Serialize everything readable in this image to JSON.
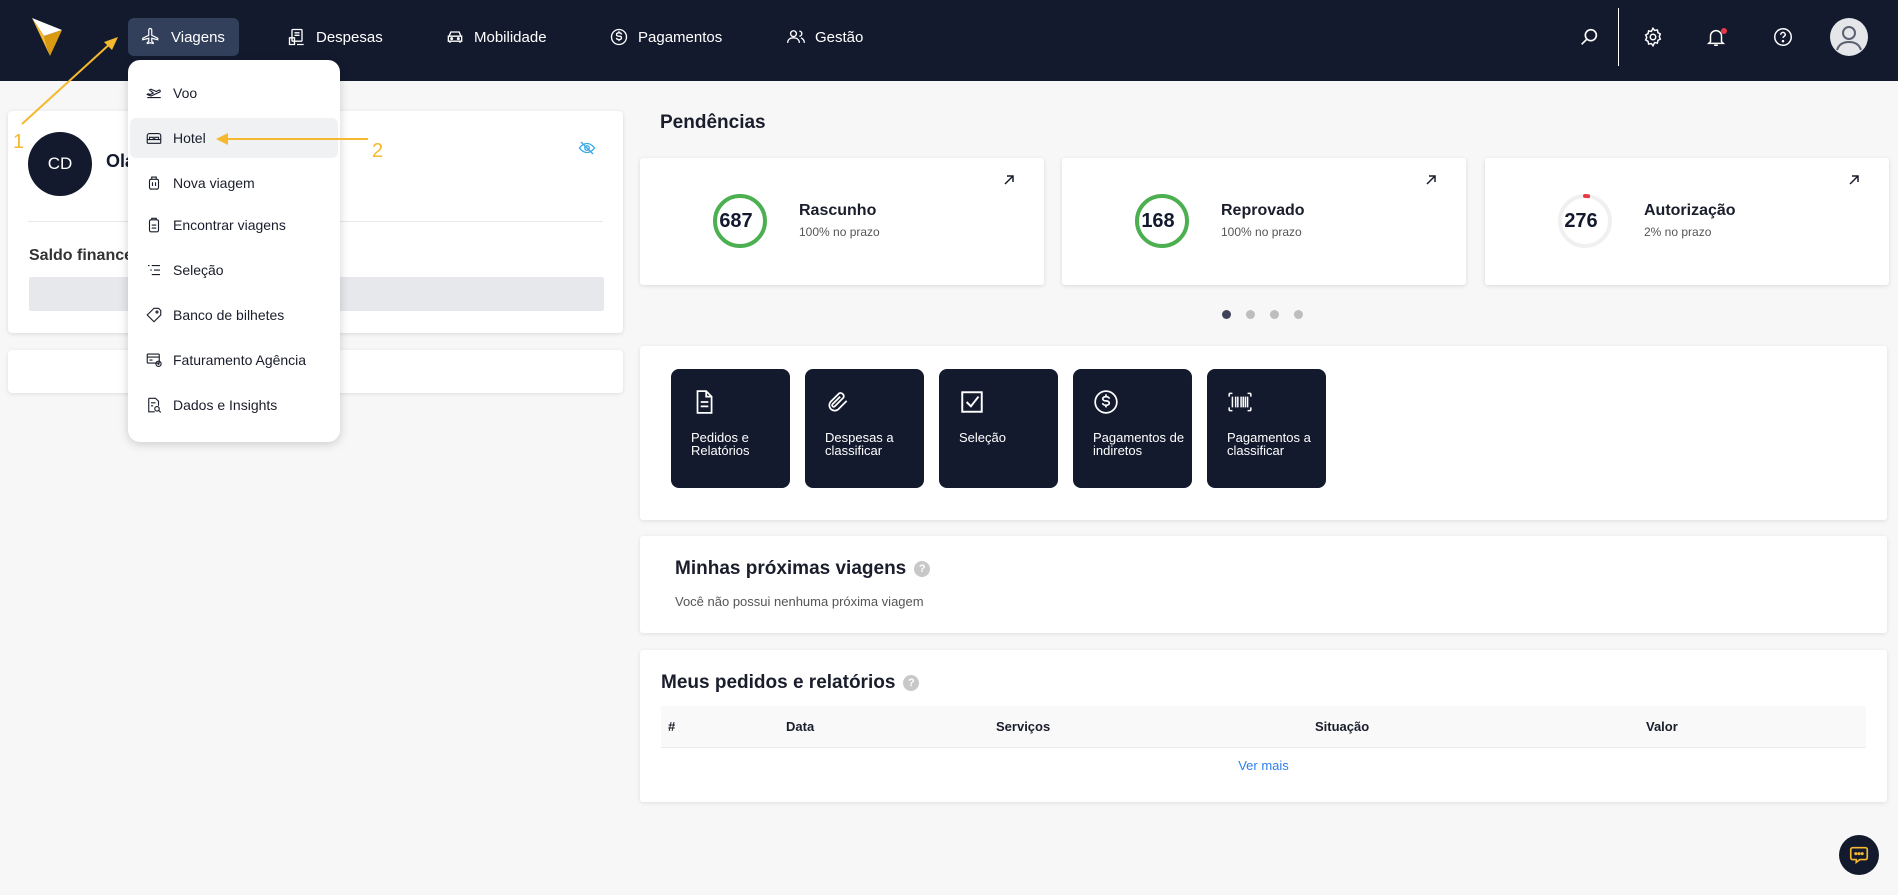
{
  "nav": {
    "items": [
      {
        "label": "Viagens",
        "icon": "plane-icon"
      },
      {
        "label": "Despesas",
        "icon": "receipt-icon"
      },
      {
        "label": "Mobilidade",
        "icon": "car-icon"
      },
      {
        "label": "Pagamentos",
        "icon": "dollar-icon"
      },
      {
        "label": "Gestão",
        "icon": "users-icon"
      }
    ],
    "active": "Viagens",
    "icons_right": [
      "search-icon",
      "gear-icon",
      "bell-icon",
      "help-icon",
      "user-avatar-icon"
    ]
  },
  "dropdown": {
    "items": [
      {
        "label": "Voo",
        "icon": "plane-takeoff-icon"
      },
      {
        "label": "Hotel",
        "icon": "bed-icon"
      },
      {
        "label": "Nova viagem",
        "icon": "luggage-icon"
      },
      {
        "label": "Encontrar viagens",
        "icon": "clipboard-icon"
      },
      {
        "label": "Seleção",
        "icon": "list-icon"
      },
      {
        "label": "Banco de bilhetes",
        "icon": "ticket-icon"
      },
      {
        "label": "Faturamento Agência",
        "icon": "billing-icon"
      },
      {
        "label": "Dados e Insights",
        "icon": "insights-icon"
      }
    ],
    "highlighted": "Hotel"
  },
  "annotations": {
    "step1": "1",
    "step2": "2"
  },
  "profile": {
    "initials": "CD",
    "greeting": "Olá",
    "saldo_label": "Saldo financeiro"
  },
  "pendencias": {
    "title": "Pendências",
    "cards": [
      {
        "count": "687",
        "label": "Rascunho",
        "sub": "100% no prazo",
        "progress": 1.0
      },
      {
        "count": "168",
        "label": "Reprovado",
        "sub": "100% no prazo",
        "progress": 1.0
      },
      {
        "count": "276",
        "label": "Autorização",
        "sub": "2% no prazo",
        "progress": 0.02
      }
    ],
    "carousel_pages": 4,
    "carousel_active": 1
  },
  "quick_actions": [
    {
      "label": "Pedidos e Relatórios",
      "icon": "document-icon"
    },
    {
      "label": "Despesas a classificar",
      "icon": "paperclip-icon"
    },
    {
      "label": "Seleção",
      "icon": "checkbox-icon"
    },
    {
      "label": "Pagamentos de indiretos",
      "icon": "dollar-circle-icon"
    },
    {
      "label": "Pagamentos a classificar",
      "icon": "barcode-icon"
    }
  ],
  "proximas_viagens": {
    "title": "Minhas próximas viagens",
    "empty_text": "Você não possui nenhuma próxima viagem",
    "help": "?"
  },
  "pedidos": {
    "title": "Meus pedidos e relatórios",
    "help": "?",
    "columns": [
      "#",
      "Data",
      "Serviços",
      "Situação",
      "Valor"
    ],
    "ver_mais": "Ver mais"
  },
  "colors": {
    "topbar": "#141a2e",
    "accent": "#f5b82e",
    "ring_ok": "#4caf50",
    "ring_alert": "#e63946"
  }
}
